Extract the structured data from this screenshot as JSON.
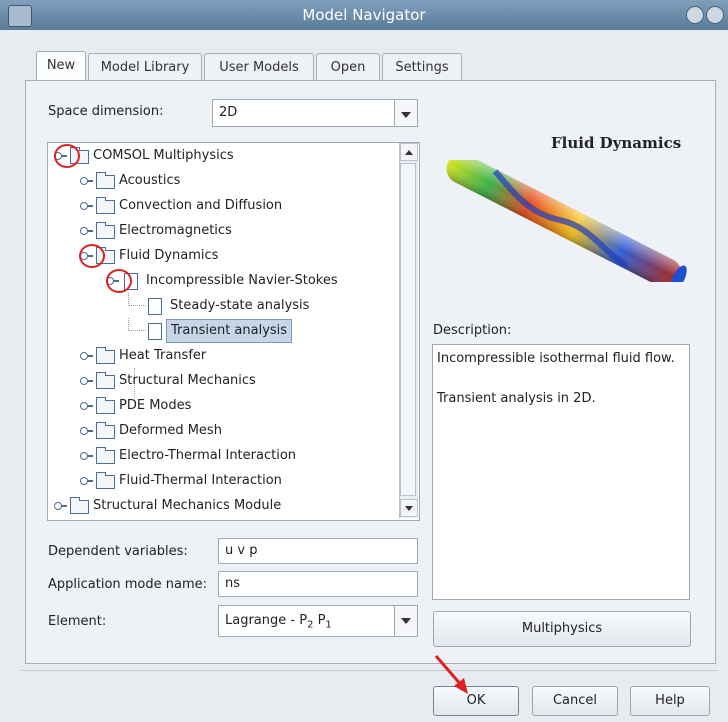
{
  "window": {
    "title": "Model Navigator"
  },
  "tabs": [
    {
      "label": "New",
      "active": true
    },
    {
      "label": "Model Library",
      "active": false
    },
    {
      "label": "User Models",
      "active": false
    },
    {
      "label": "Open",
      "active": false
    },
    {
      "label": "Settings",
      "active": false
    }
  ],
  "space_dimension": {
    "label": "Space dimension:",
    "value": "2D"
  },
  "tree": {
    "items": [
      {
        "label": "COMSOL Multiphysics",
        "icon": "folder-icon",
        "level": 0,
        "selected": false
      },
      {
        "label": "Acoustics",
        "icon": "folder-icon",
        "level": 1,
        "selected": false
      },
      {
        "label": "Convection and Diffusion",
        "icon": "folder-icon",
        "level": 1,
        "selected": false
      },
      {
        "label": "Electromagnetics",
        "icon": "folder-icon",
        "level": 1,
        "selected": false
      },
      {
        "label": "Fluid Dynamics",
        "icon": "folder-icon",
        "level": 1,
        "selected": false
      },
      {
        "label": "Incompressible Navier-Stokes",
        "icon": "document-icon",
        "level": 2,
        "selected": false
      },
      {
        "label": "Steady-state analysis",
        "icon": "document-icon",
        "level": 3,
        "selected": false
      },
      {
        "label": "Transient analysis",
        "icon": "document-icon",
        "level": 3,
        "selected": true
      },
      {
        "label": "Heat Transfer",
        "icon": "folder-icon",
        "level": 1,
        "selected": false
      },
      {
        "label": "Structural Mechanics",
        "icon": "folder-icon",
        "level": 1,
        "selected": false
      },
      {
        "label": "PDE Modes",
        "icon": "folder-icon",
        "level": 1,
        "selected": false
      },
      {
        "label": "Deformed Mesh",
        "icon": "folder-icon",
        "level": 1,
        "selected": false
      },
      {
        "label": "Electro-Thermal Interaction",
        "icon": "folder-icon",
        "level": 1,
        "selected": false
      },
      {
        "label": "Fluid-Thermal Interaction",
        "icon": "folder-icon",
        "level": 1,
        "selected": false
      },
      {
        "label": "Structural Mechanics Module",
        "icon": "folder-icon",
        "level": 0,
        "selected": false
      }
    ]
  },
  "preview": {
    "title": "Fluid Dynamics"
  },
  "description": {
    "label": "Description:",
    "line1": "Incompressible isothermal fluid flow.",
    "line2": "Transient analysis in 2D."
  },
  "form": {
    "dependent_variables": {
      "label": "Dependent variables:",
      "value": "u v p"
    },
    "application_mode_name": {
      "label": "Application mode name:",
      "value": "ns"
    },
    "element": {
      "label": "Element:",
      "value_main": "Lagrange - P",
      "sub1": "2",
      "space": " P",
      "sub2": "1"
    }
  },
  "buttons": {
    "multiphysics": "Multiphysics",
    "ok": "OK",
    "cancel": "Cancel",
    "help": "Help"
  },
  "colors": {
    "annotation_red": "#e02020",
    "selection": "#c6d6e8",
    "titlebar": "#6a8aa7"
  }
}
